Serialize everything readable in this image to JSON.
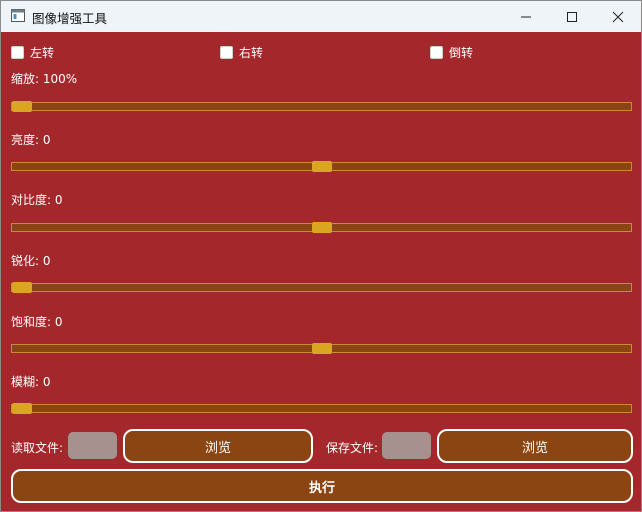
{
  "window": {
    "title": "图像增强工具"
  },
  "checkboxes": [
    {
      "label": "左转",
      "checked": false
    },
    {
      "label": "右转",
      "checked": false
    },
    {
      "label": "倒转",
      "checked": false
    }
  ],
  "sliders": [
    {
      "label": "缩放: 100%",
      "fraction": 0.016
    },
    {
      "label": "亮度: 0",
      "fraction": 0.5
    },
    {
      "label": "对比度: 0",
      "fraction": 0.5
    },
    {
      "label": "锐化: 0",
      "fraction": 0.016
    },
    {
      "label": "饱和度: 0",
      "fraction": 0.5
    },
    {
      "label": "模糊: 0",
      "fraction": 0.016
    }
  ],
  "files": {
    "read_label": "读取文件:",
    "read_value": "",
    "browse1": "浏览",
    "save_label": "保存文件:",
    "save_value": "",
    "browse2": "浏览"
  },
  "execute": "执行",
  "colors": {
    "background": "#a4282b",
    "track": "#8b4513",
    "handle": "#daa520",
    "button": "#8b4513",
    "field": "#a6918f"
  }
}
